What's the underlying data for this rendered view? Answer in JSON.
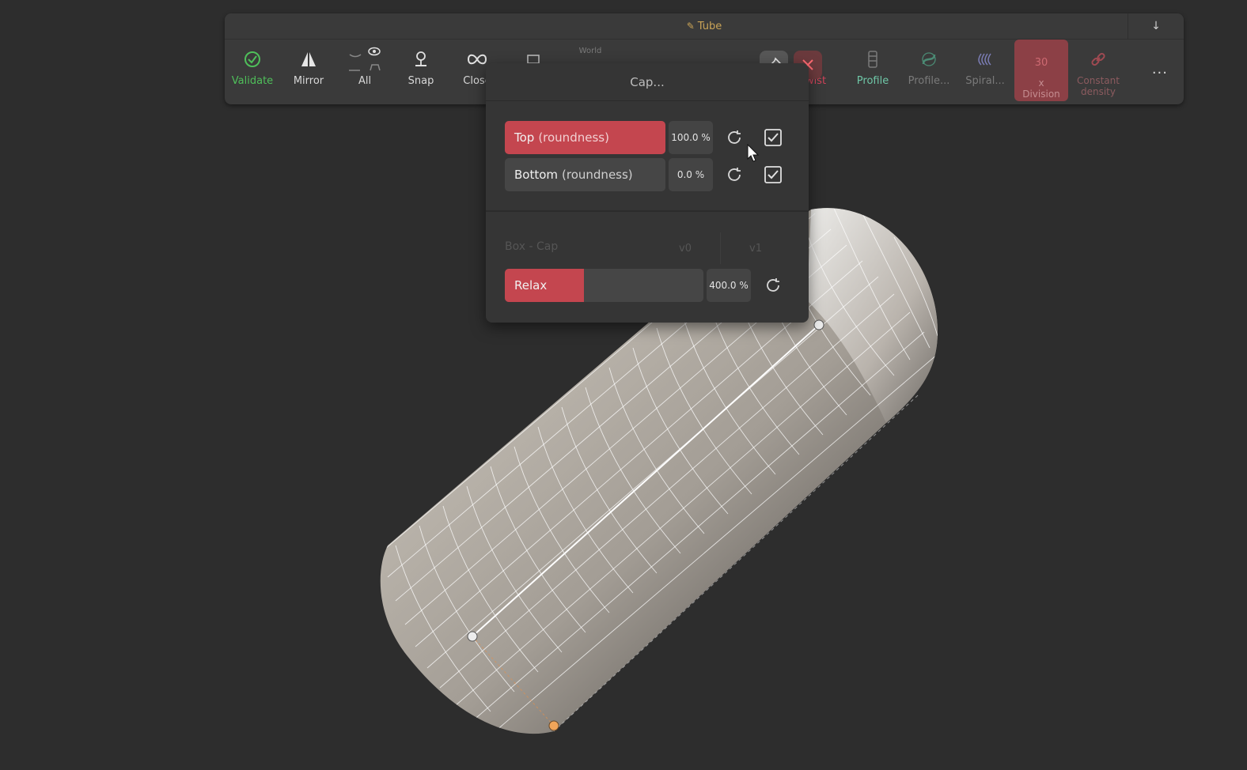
{
  "toolbar": {
    "title": "Tube",
    "collapse_icon": "arrow-down-icon",
    "tools": [
      {
        "id": "validate",
        "label": "Validate",
        "icon": "check-circle-icon"
      },
      {
        "id": "mirror",
        "label": "Mirror",
        "icon": "mirror-icon"
      },
      {
        "id": "all",
        "label": "All",
        "icon": "eye-icon"
      },
      {
        "id": "snap",
        "label": "Snap",
        "icon": "snap-icon"
      },
      {
        "id": "close",
        "label": "Close",
        "icon": "infinity-icon"
      },
      {
        "id": "twist",
        "label": "wist",
        "icon": "twist-icon"
      },
      {
        "id": "profile",
        "label": "Profile",
        "icon": "profile-icon"
      },
      {
        "id": "profile2",
        "label": "Profile...",
        "icon": "profile-shape-icon"
      },
      {
        "id": "spiral",
        "label": "Spiral...",
        "icon": "spiral-icon"
      },
      {
        "id": "division",
        "label": "x\nDivision",
        "value": "30"
      },
      {
        "id": "constant_density",
        "label": "Constant\ndensity",
        "icon": "link-icon"
      }
    ],
    "world_label": "World",
    "more_label": "..."
  },
  "popup": {
    "title": "Cap...",
    "top": {
      "name": "Top",
      "suffix": "(roundness)",
      "value": "100.0 %",
      "fill": 1.0,
      "checked": true
    },
    "bottom": {
      "name": "Bottom",
      "suffix": "(roundness)",
      "value": "0.0 %",
      "fill": 0.0,
      "checked": true
    },
    "box_cap": {
      "label": "Box - Cap",
      "v0": "v0",
      "v1": "v1"
    },
    "relax": {
      "name": "Relax",
      "value": "400.0 %",
      "fill": 0.4
    }
  },
  "colors": {
    "accent": "#c4464f",
    "validate": "#4fbf5a",
    "profile": "#6fc7a7",
    "title": "#caa457"
  }
}
